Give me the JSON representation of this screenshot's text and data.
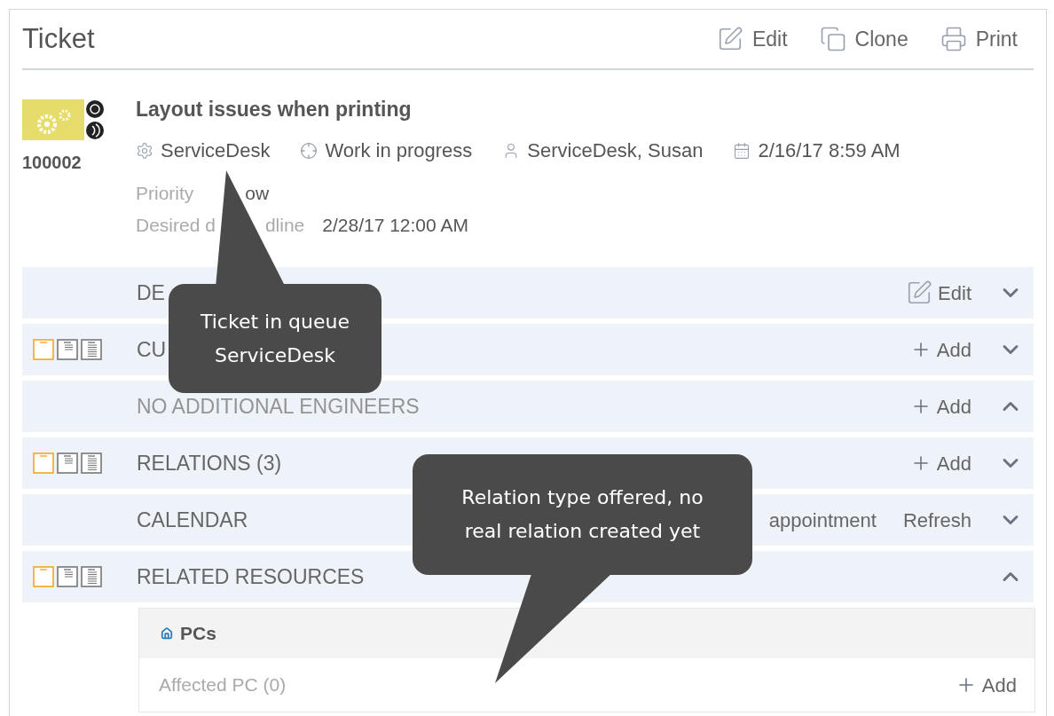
{
  "header": {
    "title": "Ticket",
    "actions": [
      {
        "kind": "edit",
        "label": "Edit"
      },
      {
        "kind": "clone",
        "label": "Clone"
      },
      {
        "kind": "print",
        "label": "Print"
      }
    ]
  },
  "ticket": {
    "number": "100002",
    "title": "Layout issues when printing",
    "meta": [
      {
        "kind": "queue",
        "text": "ServiceDesk"
      },
      {
        "kind": "status",
        "text": "Work in progress"
      },
      {
        "kind": "person",
        "text": "ServiceDesk, Susan"
      },
      {
        "kind": "date",
        "text": "2/16/17 8:59 AM"
      }
    ],
    "fields": [
      {
        "label": "Priority",
        "value": "ow"
      },
      {
        "label": "Desired d",
        "label_rest": "dline",
        "value": "2/28/17 12:00 AM"
      }
    ]
  },
  "sections": [
    {
      "title": "DE",
      "expanded": false,
      "empty": false,
      "actions": [
        {
          "kind": "edit",
          "label": "Edit"
        }
      ]
    },
    {
      "title": "CU",
      "expanded": false,
      "empty": false,
      "view_modes": [
        {
          "selected": true
        },
        {
          "selected": false
        },
        {
          "selected": false
        }
      ],
      "actions": [
        {
          "kind": "add",
          "label": "Add"
        }
      ]
    },
    {
      "title": "NO ADDITIONAL ENGINEERS",
      "expanded": true,
      "empty": true,
      "actions": [
        {
          "kind": "add",
          "label": "Add"
        }
      ]
    },
    {
      "title": "RELATIONS (3)",
      "expanded": false,
      "empty": false,
      "view_modes": [
        {
          "selected": true
        },
        {
          "selected": false
        },
        {
          "selected": false
        }
      ],
      "actions": [
        {
          "kind": "add",
          "label": "Add"
        }
      ]
    },
    {
      "title": "CALENDAR",
      "expanded": false,
      "empty": false,
      "actions": [
        {
          "kind": "text",
          "label": "appointment"
        },
        {
          "kind": "text",
          "label": "Refresh"
        }
      ]
    },
    {
      "title": "RELATED RESOURCES",
      "expanded": true,
      "empty": false,
      "view_modes": [
        {
          "selected": true
        },
        {
          "selected": false
        },
        {
          "selected": false
        }
      ]
    }
  ],
  "resources_panel": {
    "title": "PCs",
    "rows": [
      {
        "label": "Affected PC (0)",
        "action": "Add"
      }
    ]
  },
  "callouts": [
    {
      "lines": [
        "Ticket in queue",
        "ServiceDesk"
      ]
    },
    {
      "lines": [
        "Relation type offered, no",
        "real relation created yet"
      ]
    }
  ]
}
